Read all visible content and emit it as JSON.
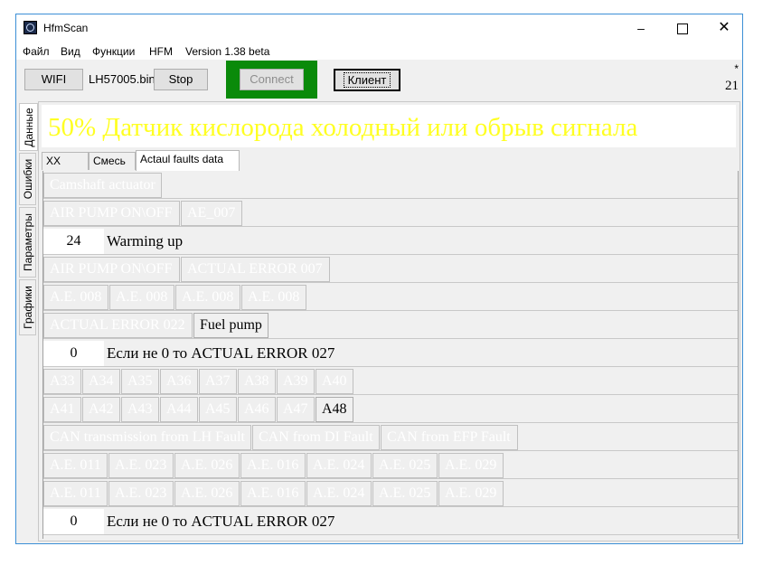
{
  "window": {
    "title": "HfmScan",
    "minimize": "–",
    "maximize": "",
    "close": "✕"
  },
  "menu": [
    "Файл",
    "Вид",
    "Функции",
    "HFM",
    "Version 1.38 beta"
  ],
  "toolbar": {
    "wifi": "WIFI",
    "file": "LH57005.bin",
    "stop": "Stop",
    "connect": "Connect",
    "client": "Клиент",
    "star": "*",
    "counter": "21"
  },
  "side_tabs": [
    "Данные",
    "Ошибки",
    "Параметры",
    "Графики"
  ],
  "banner": {
    "text": "50%  Датчик кислорода холодный или обрыв сигнала",
    "color": "#ffff22"
  },
  "tabs": [
    "XX",
    "Смесь",
    "Actaul faults data"
  ],
  "rows": [
    {
      "type": "cells",
      "cells": [
        {
          "label": "Camshaft actuator",
          "active": false
        }
      ]
    },
    {
      "type": "cells",
      "cells": [
        {
          "label": "AIR PUMP ON\\OFF",
          "active": false
        },
        {
          "label": "AE_007",
          "active": false
        }
      ]
    },
    {
      "type": "value",
      "value": "24",
      "text": "Warming up"
    },
    {
      "type": "cells",
      "cells": [
        {
          "label": "AIR PUMP ON\\OFF",
          "active": false
        },
        {
          "label": "ACTUAL ERROR 007",
          "active": false
        }
      ]
    },
    {
      "type": "cells",
      "cells": [
        {
          "label": "A.E. 008",
          "active": false
        },
        {
          "label": "A.E. 008",
          "active": false
        },
        {
          "label": "A.E. 008",
          "active": false
        },
        {
          "label": "A.E. 008",
          "active": false
        }
      ]
    },
    {
      "type": "cells",
      "cells": [
        {
          "label": "ACTUAL ERROR 022",
          "active": false
        },
        {
          "label": "Fuel pump",
          "active": true
        }
      ]
    },
    {
      "type": "value",
      "value": "0",
      "text": "Если не 0 то ACTUAL ERROR 027"
    },
    {
      "type": "cells",
      "cells": [
        {
          "label": "A33",
          "active": false
        },
        {
          "label": "A34",
          "active": false
        },
        {
          "label": "A35",
          "active": false
        },
        {
          "label": "A36",
          "active": false
        },
        {
          "label": "A37",
          "active": false
        },
        {
          "label": "A38",
          "active": false
        },
        {
          "label": "A39",
          "active": false
        },
        {
          "label": "A40",
          "active": false
        }
      ]
    },
    {
      "type": "cells",
      "cells": [
        {
          "label": "A41",
          "active": false
        },
        {
          "label": "A42",
          "active": false
        },
        {
          "label": "A43",
          "active": false
        },
        {
          "label": "A44",
          "active": false
        },
        {
          "label": "A45",
          "active": false
        },
        {
          "label": "A46",
          "active": false
        },
        {
          "label": "A47",
          "active": false
        },
        {
          "label": "A48",
          "active": true
        }
      ]
    },
    {
      "type": "cells",
      "cells": [
        {
          "label": "CAN transmission from LH Fault",
          "active": false
        },
        {
          "label": "CAN from DI Fault",
          "active": false
        },
        {
          "label": "CAN from EFP Fault",
          "active": false
        }
      ]
    },
    {
      "type": "cells",
      "cells": [
        {
          "label": "A.E. 011",
          "active": false
        },
        {
          "label": "A.E. 023",
          "active": false
        },
        {
          "label": "A.E. 026",
          "active": false
        },
        {
          "label": "A.E. 016",
          "active": false
        },
        {
          "label": "A.E. 024",
          "active": false
        },
        {
          "label": "A.E. 025",
          "active": false
        },
        {
          "label": "A.E. 029",
          "active": false
        }
      ]
    },
    {
      "type": "cells",
      "cells": [
        {
          "label": "A.E. 011",
          "active": false
        },
        {
          "label": "A.E. 023",
          "active": false
        },
        {
          "label": "A.E. 026",
          "active": false
        },
        {
          "label": "A.E. 016",
          "active": false
        },
        {
          "label": "A.E. 024",
          "active": false
        },
        {
          "label": "A.E. 025",
          "active": false
        },
        {
          "label": "A.E. 029",
          "active": false
        }
      ]
    },
    {
      "type": "value",
      "value": "0",
      "text": "Если не 0 то ACTUAL ERROR 027"
    }
  ]
}
